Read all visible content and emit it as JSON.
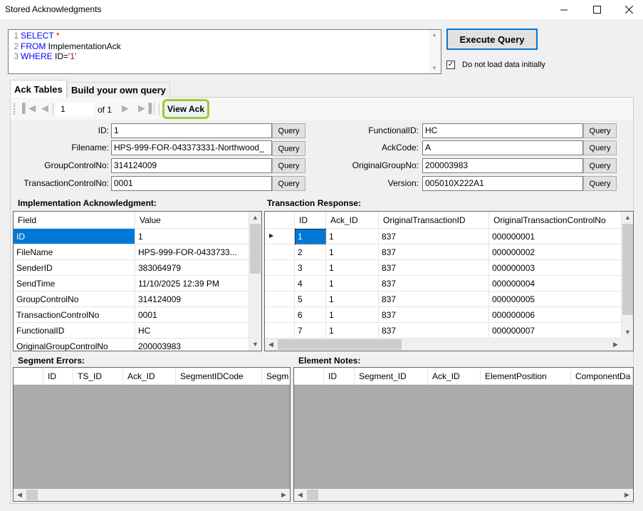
{
  "window": {
    "title": "Stored Acknowledgments"
  },
  "sql": {
    "lines": [
      {
        "num": "1",
        "kw": "SELECT",
        "rest": " ",
        "extra": "*"
      },
      {
        "num": "2",
        "kw": "FROM",
        "rest": " ImplementationAck",
        "extra": ""
      },
      {
        "num": "3",
        "kw": "WHERE",
        "rest": " ID=",
        "extra": "'1'"
      }
    ]
  },
  "execute_label": "Execute Query",
  "no_load": {
    "label": "Do not load data initially",
    "checked": true
  },
  "tabs": [
    {
      "label": "Ack Tables",
      "active": true
    },
    {
      "label": "Build your own query",
      "active": false
    }
  ],
  "navigator": {
    "position": "1",
    "of_label": "of 1",
    "view_ack": "View Ack"
  },
  "fields": {
    "query_label": "Query",
    "left": [
      {
        "label": "ID:",
        "value": "1"
      },
      {
        "label": "Filename:",
        "value": "HPS-999-FOR-043373331-Northwood_"
      },
      {
        "label": "GroupControlNo:",
        "value": "314124009"
      },
      {
        "label": "TransactionControlNo:",
        "value": "0001"
      }
    ],
    "right": [
      {
        "label": "FunctionalID:",
        "value": "HC"
      },
      {
        "label": "AckCode:",
        "value": "A"
      },
      {
        "label": "OriginalGroupNo:",
        "value": "200003983"
      },
      {
        "label": "Version:",
        "value": "005010X222A1"
      }
    ]
  },
  "impl_ack": {
    "title": "Implementation Acknowledgment:",
    "columns": [
      "Field",
      "Value"
    ],
    "rows": [
      [
        "ID",
        "1"
      ],
      [
        "FileName",
        "HPS-999-FOR-0433733..."
      ],
      [
        "SenderID",
        "383064979"
      ],
      [
        "SendTime",
        "11/10/2025 12:39 PM"
      ],
      [
        "GroupControlNo",
        "314124009"
      ],
      [
        "TransactionControlNo",
        "0001"
      ],
      [
        "FunctionalID",
        "HC"
      ],
      [
        "OriginalGroupControlNo",
        "200003983"
      ]
    ]
  },
  "trans_resp": {
    "title": "Transaction Response:",
    "columns": [
      "ID",
      "Ack_ID",
      "OriginalTransactionID",
      "OriginalTransactionControlNo"
    ],
    "rows": [
      [
        "1",
        "1",
        "837",
        "000000001"
      ],
      [
        "2",
        "1",
        "837",
        "000000002"
      ],
      [
        "3",
        "1",
        "837",
        "000000003"
      ],
      [
        "4",
        "1",
        "837",
        "000000004"
      ],
      [
        "5",
        "1",
        "837",
        "000000005"
      ],
      [
        "6",
        "1",
        "837",
        "000000006"
      ],
      [
        "7",
        "1",
        "837",
        "000000007"
      ]
    ]
  },
  "segment_errors": {
    "title": "Segment Errors:",
    "columns": [
      "ID",
      "TS_ID",
      "Ack_ID",
      "SegmentIDCode",
      "Segm"
    ]
  },
  "element_notes": {
    "title": "Element Notes:",
    "columns": [
      "ID",
      "Segment_ID",
      "Ack_ID",
      "ElementPosition",
      "ComponentDa"
    ]
  }
}
